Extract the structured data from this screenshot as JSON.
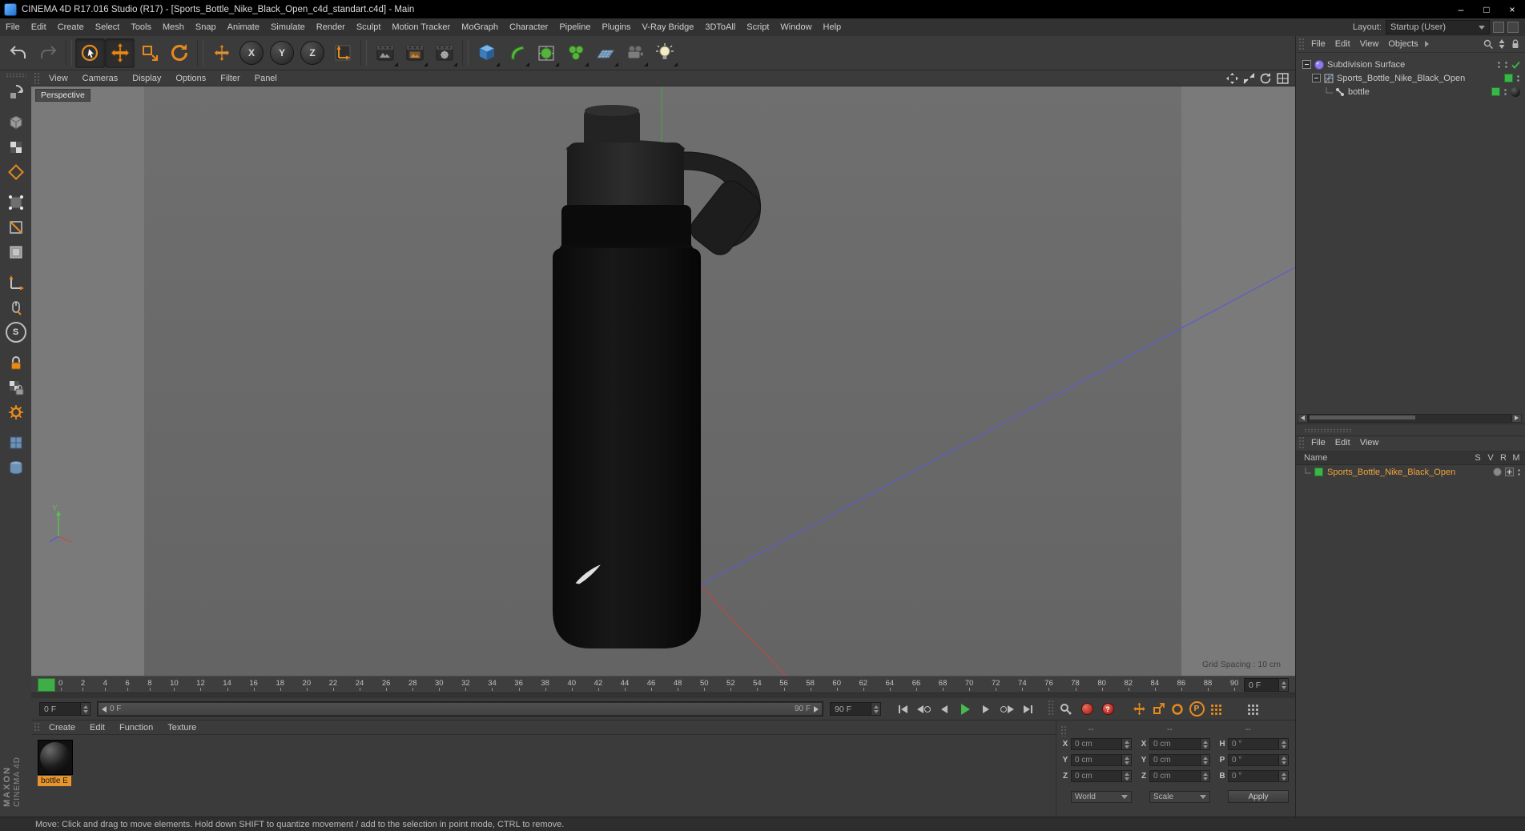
{
  "window": {
    "title": "CINEMA 4D R17.016 Studio (R17) - [Sports_Bottle_Nike_Black_Open_c4d_standart.c4d] - Main",
    "controls": {
      "minimize": "–",
      "maximize": "□",
      "close": "×"
    }
  },
  "menubar": {
    "items": [
      "File",
      "Edit",
      "Create",
      "Select",
      "Tools",
      "Mesh",
      "Snap",
      "Animate",
      "Simulate",
      "Render",
      "Sculpt",
      "Motion Tracker",
      "MoGraph",
      "Character",
      "Pipeline",
      "Plugins",
      "V-Ray Bridge",
      "3DToAll",
      "Script",
      "Window",
      "Help"
    ],
    "layout_label": "Layout:",
    "layout_value": "Startup (User)"
  },
  "toolbar": {
    "axis_x": "X",
    "axis_y": "Y",
    "axis_z": "Z",
    "icons": [
      "undo-icon",
      "redo-icon",
      "live-selection-icon",
      "move-icon",
      "scale-icon",
      "rotate-icon",
      "recent-tool-icon",
      "coordinate-system-icon",
      "render-view-icon",
      "render-picture-viewer-icon",
      "render-settings-icon",
      "cube-icon",
      "pen-icon",
      "subdivision-icon",
      "cloner-icon",
      "floor-icon",
      "camera-icon",
      "light-icon"
    ]
  },
  "left_toolbar": {
    "snap_label": "S",
    "icons": [
      "make-editable-icon",
      "model-mode-icon",
      "texture-mode-icon",
      "workplane-icon",
      "points-mode-icon",
      "edges-mode-icon",
      "polygons-mode-icon",
      "axis-mode-icon",
      "viewport-select-icon",
      "snap-icon",
      "lock-workplane-icon",
      "texture-lock-icon",
      "modeling-settings-icon",
      "uv-tool-icon",
      "content-browser-icon"
    ]
  },
  "viewport": {
    "menu": [
      "View",
      "Cameras",
      "Display",
      "Options",
      "Filter",
      "Panel"
    ],
    "camera_label": "Perspective",
    "grid_spacing": "Grid Spacing : 10 cm",
    "axis_gizmo_y": "Y",
    "corner_icons": [
      "pan-view-icon",
      "zoom-view-icon",
      "rotate-view-icon",
      "toggle-view-icon"
    ]
  },
  "object_manager": {
    "menu": [
      "File",
      "Edit",
      "View",
      "Objects"
    ],
    "items": [
      {
        "label": "Subdivision Surface"
      },
      {
        "label": "Sports_Bottle_Nike_Black_Open"
      },
      {
        "label": "bottle"
      }
    ]
  },
  "layer_panel": {
    "menu": [
      "File",
      "Edit",
      "View"
    ],
    "name_header": "Name",
    "columns": [
      "S",
      "V",
      "R",
      "M"
    ],
    "row_label": "Sports_Bottle_Nike_Black_Open"
  },
  "timeline": {
    "ticks": [
      "0",
      "2",
      "4",
      "6",
      "8",
      "10",
      "12",
      "14",
      "16",
      "18",
      "20",
      "22",
      "24",
      "26",
      "28",
      "30",
      "32",
      "34",
      "36",
      "38",
      "40",
      "42",
      "44",
      "46",
      "48",
      "50",
      "52",
      "54",
      "56",
      "58",
      "60",
      "62",
      "64",
      "66",
      "68",
      "70",
      "72",
      "74",
      "76",
      "78",
      "80",
      "82",
      "84",
      "86",
      "88",
      "90"
    ],
    "current_frame": "0 F",
    "start_field": "0 F",
    "range_start": "0 F",
    "range_end": "90 F",
    "end_field": "90 F",
    "transport_icons": [
      "goto-start-icon",
      "previous-key-icon",
      "previous-frame-icon",
      "play-icon",
      "next-frame-icon",
      "next-key-icon",
      "goto-end-icon",
      "record-keyframe-icon",
      "record-icon",
      "autokey-icon",
      "record-position-icon",
      "record-scale-icon",
      "record-rotation-icon",
      "record-parameter-icon",
      "record-pla-icon",
      "timeline-layout-icon"
    ],
    "autokey_glyph": "?",
    "parameter_glyph": "P"
  },
  "materials": {
    "menu": [
      "Create",
      "Edit",
      "Function",
      "Texture"
    ],
    "material_name": "bottle E"
  },
  "coordinates": {
    "headers": [
      "--",
      "--",
      "--"
    ],
    "rows": [
      {
        "l1": "X",
        "v1": "0 cm",
        "l2": "X",
        "v2": "0 cm",
        "l3": "H",
        "v3": "0 °"
      },
      {
        "l1": "Y",
        "v1": "0 cm",
        "l2": "Y",
        "v2": "0 cm",
        "l3": "P",
        "v3": "0 °"
      },
      {
        "l1": "Z",
        "v1": "0 cm",
        "l2": "Z",
        "v2": "0 cm",
        "l3": "B",
        "v3": "0 °"
      }
    ],
    "world_dropdown": "World",
    "scale_dropdown": "Scale",
    "apply_button": "Apply"
  },
  "statusbar": {
    "text": "Move: Click and drag to move elements. Hold down SHIFT to quantize movement / add to the selection in point mode, CTRL to remove."
  },
  "branding": {
    "maxon": "MAXON",
    "cinema": "CINEMA 4D"
  }
}
